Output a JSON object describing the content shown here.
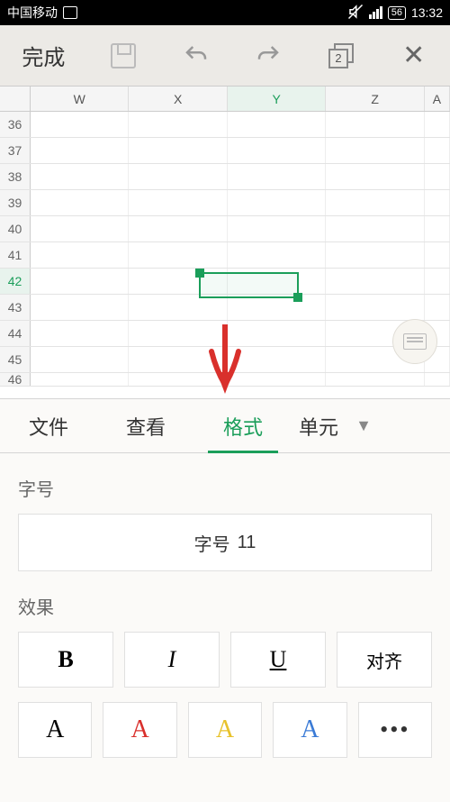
{
  "status": {
    "carrier": "中国移动",
    "battery": "56",
    "time": "13:32"
  },
  "toolbar": {
    "done": "完成",
    "layers_count": "2"
  },
  "sheet": {
    "columns": [
      "W",
      "X",
      "Y",
      "Z",
      "A"
    ],
    "active_col_index": 2,
    "rows": [
      "36",
      "37",
      "38",
      "39",
      "40",
      "41",
      "42",
      "43",
      "44",
      "45",
      "46"
    ],
    "active_row_index": 6
  },
  "tabs": {
    "items": [
      "文件",
      "查看",
      "格式",
      "单元"
    ],
    "partial": "单元",
    "active_index": 2
  },
  "format": {
    "fontsize_label": "字号",
    "fontsize_value_label": "字号",
    "fontsize_value": "11",
    "effects_label": "效果",
    "bold": "B",
    "italic": "I",
    "underline": "U",
    "align": "对齐",
    "colors": {
      "black": "#000000",
      "red": "#d9302c",
      "yellow": "#e8c22b",
      "blue": "#3b7bd6"
    }
  }
}
